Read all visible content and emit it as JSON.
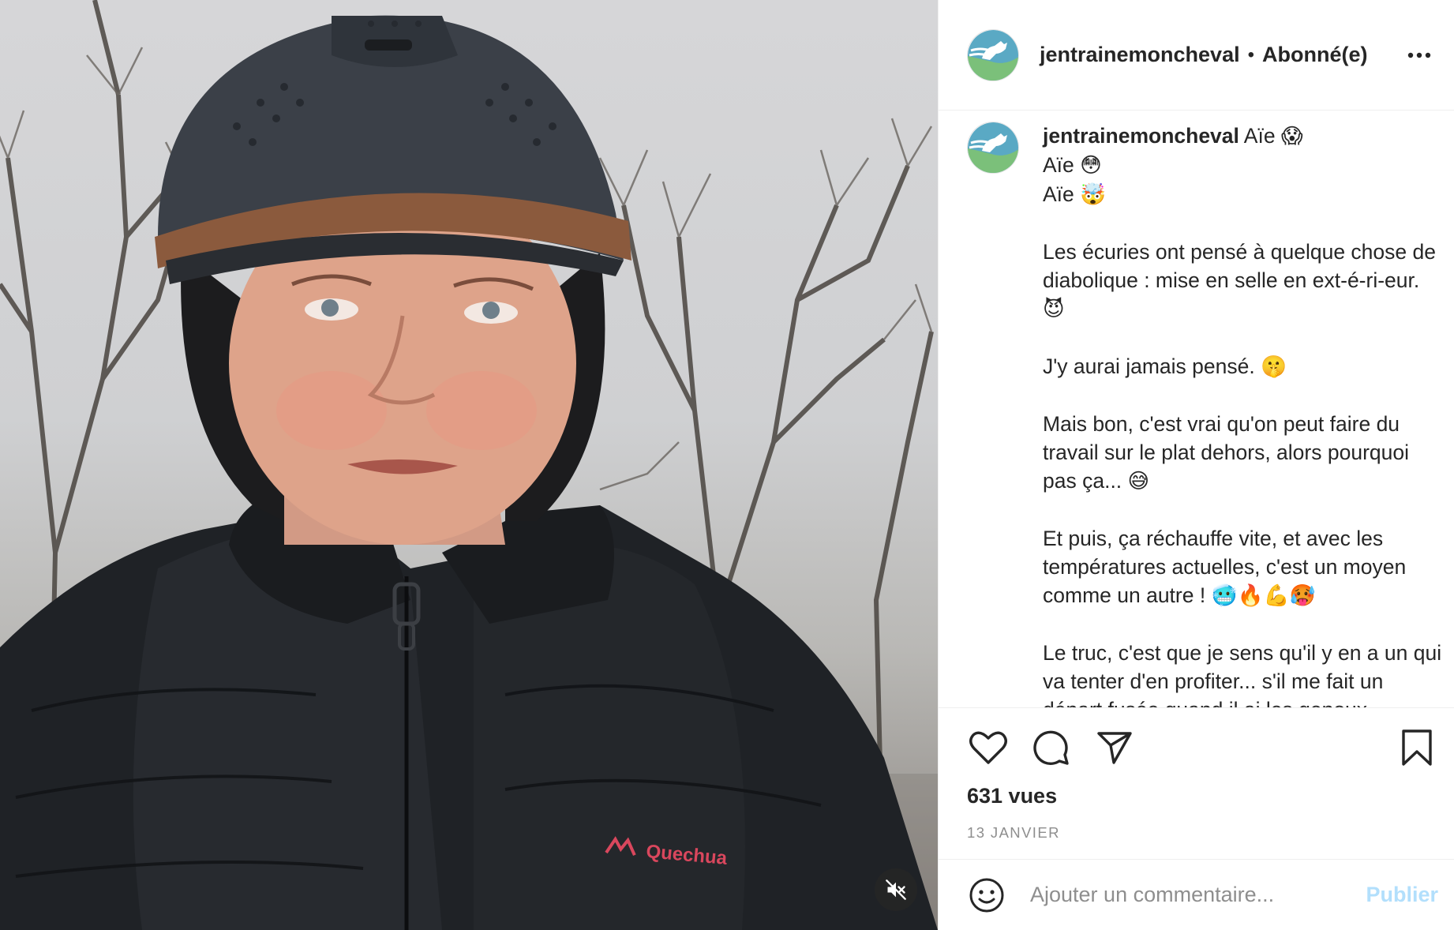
{
  "header": {
    "username": "jentrainemoncheval",
    "separator": "•",
    "follow_status": "Abonné(e)",
    "more_icon": "more-horizontal-icon"
  },
  "media": {
    "type": "video",
    "mute_icon": "speaker-muted-icon",
    "jacket_brand": "Quechua"
  },
  "caption": {
    "username": "jentrainemoncheval",
    "lines": [
      {
        "text": "Aïe",
        "emoji": "😱"
      },
      {
        "text": "Aïe",
        "emoji": "😳"
      },
      {
        "text": "Aïe",
        "emoji": "🤯"
      }
    ],
    "paragraphs": [
      {
        "text": "Les écuries ont pensé à quelque chose de diabolique : mise en selle en ext-é-ri-eur.",
        "emoji": "😈"
      },
      {
        "text": "J'y aurai jamais pensé.",
        "emoji": "🤫"
      },
      {
        "text": "Mais bon, c'est vrai qu'on peut faire du travail sur le plat dehors, alors pourquoi pas ça...",
        "emoji": "😅"
      },
      {
        "text": "Et puis, ça réchauffe vite, et avec les températures actuelles, c'est un moyen comme un autre !",
        "emoji": "🥶🔥💪🥵"
      },
      {
        "text": "Le truc, c'est que je sens qu'il y en a un qui va tenter d'en profiter... s'il me fait un départ fusée quand il ai les genoux",
        "emoji": ""
      }
    ]
  },
  "actions": {
    "like_icon": "heart-icon",
    "comment_icon": "comment-bubble-icon",
    "share_icon": "paper-plane-icon",
    "save_icon": "bookmark-icon",
    "views": "631 vues",
    "date": "13 JANVIER"
  },
  "comment_box": {
    "emoji_icon": "smiley-icon",
    "placeholder": "Ajouter un commentaire...",
    "publish_label": "Publier"
  },
  "colors": {
    "text": "#262626",
    "muted": "#8e8e8e",
    "publish_disabled": "#b2dffc",
    "border": "#efefef"
  }
}
